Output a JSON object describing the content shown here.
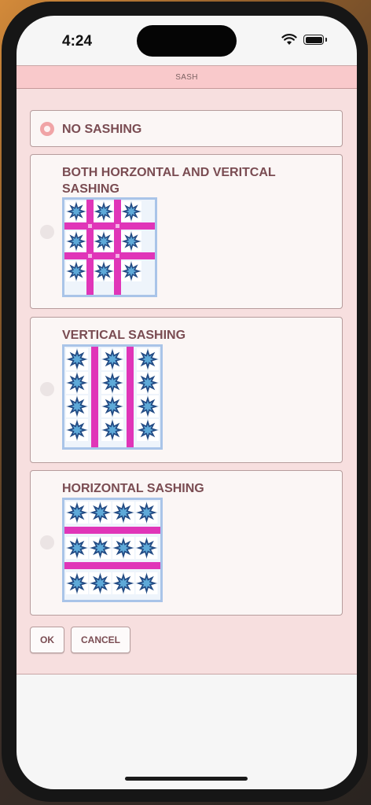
{
  "status": {
    "time": "4:24"
  },
  "dialog": {
    "title": "SASH",
    "options": [
      {
        "label": "NO SASHING",
        "selected": true
      },
      {
        "label": "BOTH HORZONTAL AND VERITCAL SASHING",
        "selected": false
      },
      {
        "label": "VERTICAL SASHING",
        "selected": false
      },
      {
        "label": "HORIZONTAL SASHING",
        "selected": false
      }
    ],
    "ok_label": "OK",
    "cancel_label": "CANCEL"
  },
  "colors": {
    "dialog_bg": "#f7dfdf",
    "titlebar": "#f9c9cb",
    "label_text": "#7a4c52",
    "sashing": "#e035b8",
    "quilt_border": "#a9c4e8",
    "star_dark": "#234b84",
    "star_light": "#5ea9d8"
  }
}
